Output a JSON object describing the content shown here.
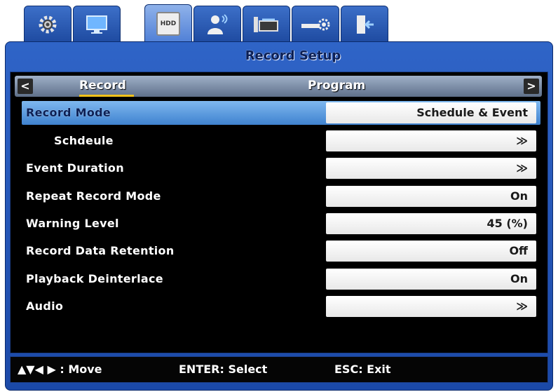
{
  "tabs": [
    {
      "id": "system",
      "icon": "gear-icon"
    },
    {
      "id": "display",
      "icon": "monitor-icon"
    },
    {
      "id": "hdd",
      "icon": "hdd-icon",
      "label": "HDD",
      "active": true
    },
    {
      "id": "user",
      "icon": "user-icon"
    },
    {
      "id": "network",
      "icon": "network-icon"
    },
    {
      "id": "device",
      "icon": "device-icon"
    },
    {
      "id": "exit",
      "icon": "exit-door-icon"
    }
  ],
  "window": {
    "title": "Record Setup"
  },
  "subtabs": {
    "left_arrow": "<",
    "right_arrow": ">",
    "tab1": "Record",
    "tab2": "Program"
  },
  "rows": [
    {
      "label": "Record Mode",
      "value": "Schedule & Event",
      "selected": true
    },
    {
      "label": "Schdeule",
      "value": "≫"
    },
    {
      "label": "Event Duration",
      "value": "≫"
    },
    {
      "label": "Repeat Record Mode",
      "value": "On"
    },
    {
      "label": "Warning Level",
      "value": "45 (%)"
    },
    {
      "label": "Record Data Retention",
      "value": "Off"
    },
    {
      "label": "Playback Deinterlace",
      "value": "On"
    },
    {
      "label": "Audio",
      "value": "≫"
    }
  ],
  "footer": {
    "move": "▲▼◀ ▶ : Move",
    "select": "ENTER: Select",
    "exit": "ESC: Exit"
  },
  "colors": {
    "accent": "#2f64c7",
    "selected": "#5a9ce0",
    "underline": "#f1c21b"
  }
}
